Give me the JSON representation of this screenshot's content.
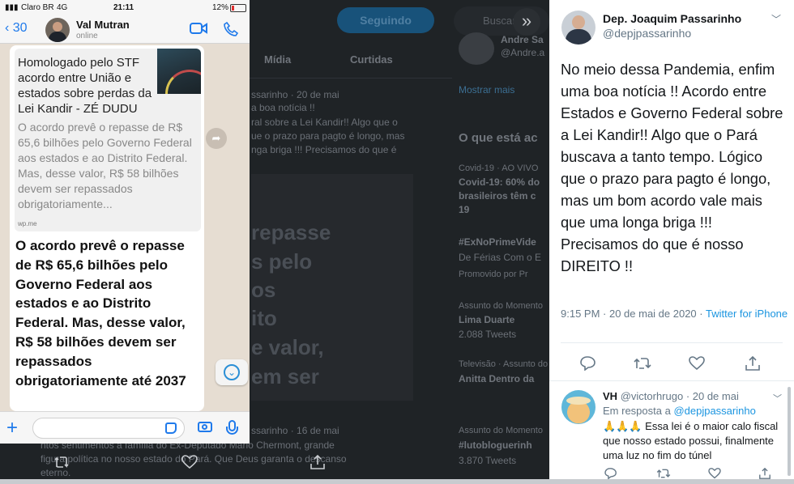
{
  "background": {
    "follow_button": "Seguindo",
    "search_placeholder": "Buscar",
    "tabs": [
      "Mídia",
      "Curtidas"
    ],
    "trending_header": "O que está ac",
    "show_more": "Mostrar mais",
    "handle_partial": "@Andre.a",
    "name_partial": "Andre Sa",
    "feed_lines": [
      "ssarinho · 20 de mai",
      "a boa notícia !!",
      "ral sobre a Lei Kandir!! Algo que o",
      "ue o prazo para pagto é longo, mas",
      "nga briga !!! Precisamos do que é"
    ],
    "feed_large": [
      "repasse",
      "s pelo",
      "os",
      "ito",
      "e valor,",
      "em ser"
    ],
    "feed_second": [
      "ssarinho · 16 de mai",
      "ntos sentimentos à família do Ex-Deputado Mário Chermont, grande",
      "figura política no nosso estado do Pará. Que Deus garanta o descanso",
      "eterno."
    ],
    "trends": [
      {
        "category": "Covid-19 · AO VIVO",
        "title": "Covid-19: 60% do",
        "sub": "brasileiros têm c",
        "extra": "19"
      },
      {
        "category": "",
        "title": "#ExNoPrimeVide",
        "sub": "De Férias Com o E",
        "extra": "Promovido por Pr"
      },
      {
        "category": "Assunto do Momento",
        "title": "Lima Duarte",
        "sub": "2.088 Tweets",
        "extra": ""
      },
      {
        "category": "Televisão · Assunto do M",
        "title": "Anitta Dentro da",
        "sub": "",
        "extra": ""
      },
      {
        "category": "Assunto do Momento",
        "title": "#lutobloguerinh",
        "sub": "3.870 Tweets",
        "extra": ""
      }
    ]
  },
  "whatsapp": {
    "status": {
      "carrier": "Claro BR",
      "network": "4G",
      "time": "21:11",
      "battery": "12%"
    },
    "back_count": "30",
    "contact_name": "Val Mutran",
    "contact_status": "online",
    "link_preview": {
      "title": "Homologado pelo STF acordo entre União e estados sobre perdas da Lei Kandir - ZÉ DUDU",
      "description": "O acordo prevê o repasse de R$ 65,6 bilhões pelo Governo Federal aos estados e ao Distrito Federal. Mas, desse valor, R$ 58 bilhões devem ser repassados obrigatoriamente...",
      "source": "wp.me"
    },
    "message": "O acordo prevê o repasse de R$ 65,6 bilhões pelo Governo Federal aos estados e ao Distrito Federal. Mas, desse valor, R$ 58 bilhões devem ser repassados obrigatoriamente até 2037"
  },
  "tweet": {
    "name": "Dep. Joaquim Passarinho",
    "handle": "@depjpassarinho",
    "text": "No meio dessa Pandemia, enfim uma boa notícia !! Acordo entre Estados e Governo Federal sobre a Lei Kandir!! Algo que o Pará buscava a tanto tempo. Lógico que o prazo para pagto é longo, mas um bom acordo vale mais que uma longa briga !!! Precisamos do que é nosso DIREITO !!",
    "time": "9:15 PM · 20 de mai de 2020 · ",
    "source": "Twitter for iPhone"
  },
  "reply": {
    "name": "VH",
    "handle": "@victorhrugo",
    "date": " · 20 de mai",
    "in_reply_prefix": "Em resposta a ",
    "in_reply_handle": "@depjpassarinho",
    "text": "🙏🙏🙏 Essa lei é o maior calo fiscal que nosso estado possui, finalmente uma luz no fim do túnel"
  }
}
